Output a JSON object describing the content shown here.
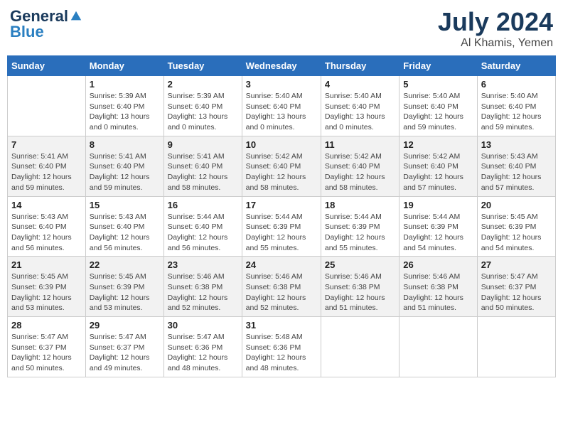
{
  "header": {
    "logo_general": "General",
    "logo_blue": "Blue",
    "month_year": "July 2024",
    "location": "Al Khamis, Yemen"
  },
  "days_of_week": [
    "Sunday",
    "Monday",
    "Tuesday",
    "Wednesday",
    "Thursday",
    "Friday",
    "Saturday"
  ],
  "weeks": [
    [
      {
        "day": "",
        "sunrise": "",
        "sunset": "",
        "daylight": ""
      },
      {
        "day": "1",
        "sunrise": "Sunrise: 5:39 AM",
        "sunset": "Sunset: 6:40 PM",
        "daylight": "Daylight: 13 hours and 0 minutes."
      },
      {
        "day": "2",
        "sunrise": "Sunrise: 5:39 AM",
        "sunset": "Sunset: 6:40 PM",
        "daylight": "Daylight: 13 hours and 0 minutes."
      },
      {
        "day": "3",
        "sunrise": "Sunrise: 5:40 AM",
        "sunset": "Sunset: 6:40 PM",
        "daylight": "Daylight: 13 hours and 0 minutes."
      },
      {
        "day": "4",
        "sunrise": "Sunrise: 5:40 AM",
        "sunset": "Sunset: 6:40 PM",
        "daylight": "Daylight: 13 hours and 0 minutes."
      },
      {
        "day": "5",
        "sunrise": "Sunrise: 5:40 AM",
        "sunset": "Sunset: 6:40 PM",
        "daylight": "Daylight: 12 hours and 59 minutes."
      },
      {
        "day": "6",
        "sunrise": "Sunrise: 5:40 AM",
        "sunset": "Sunset: 6:40 PM",
        "daylight": "Daylight: 12 hours and 59 minutes."
      }
    ],
    [
      {
        "day": "7",
        "sunrise": "Sunrise: 5:41 AM",
        "sunset": "Sunset: 6:40 PM",
        "daylight": "Daylight: 12 hours and 59 minutes."
      },
      {
        "day": "8",
        "sunrise": "Sunrise: 5:41 AM",
        "sunset": "Sunset: 6:40 PM",
        "daylight": "Daylight: 12 hours and 59 minutes."
      },
      {
        "day": "9",
        "sunrise": "Sunrise: 5:41 AM",
        "sunset": "Sunset: 6:40 PM",
        "daylight": "Daylight: 12 hours and 58 minutes."
      },
      {
        "day": "10",
        "sunrise": "Sunrise: 5:42 AM",
        "sunset": "Sunset: 6:40 PM",
        "daylight": "Daylight: 12 hours and 58 minutes."
      },
      {
        "day": "11",
        "sunrise": "Sunrise: 5:42 AM",
        "sunset": "Sunset: 6:40 PM",
        "daylight": "Daylight: 12 hours and 58 minutes."
      },
      {
        "day": "12",
        "sunrise": "Sunrise: 5:42 AM",
        "sunset": "Sunset: 6:40 PM",
        "daylight": "Daylight: 12 hours and 57 minutes."
      },
      {
        "day": "13",
        "sunrise": "Sunrise: 5:43 AM",
        "sunset": "Sunset: 6:40 PM",
        "daylight": "Daylight: 12 hours and 57 minutes."
      }
    ],
    [
      {
        "day": "14",
        "sunrise": "Sunrise: 5:43 AM",
        "sunset": "Sunset: 6:40 PM",
        "daylight": "Daylight: 12 hours and 56 minutes."
      },
      {
        "day": "15",
        "sunrise": "Sunrise: 5:43 AM",
        "sunset": "Sunset: 6:40 PM",
        "daylight": "Daylight: 12 hours and 56 minutes."
      },
      {
        "day": "16",
        "sunrise": "Sunrise: 5:44 AM",
        "sunset": "Sunset: 6:40 PM",
        "daylight": "Daylight: 12 hours and 56 minutes."
      },
      {
        "day": "17",
        "sunrise": "Sunrise: 5:44 AM",
        "sunset": "Sunset: 6:39 PM",
        "daylight": "Daylight: 12 hours and 55 minutes."
      },
      {
        "day": "18",
        "sunrise": "Sunrise: 5:44 AM",
        "sunset": "Sunset: 6:39 PM",
        "daylight": "Daylight: 12 hours and 55 minutes."
      },
      {
        "day": "19",
        "sunrise": "Sunrise: 5:44 AM",
        "sunset": "Sunset: 6:39 PM",
        "daylight": "Daylight: 12 hours and 54 minutes."
      },
      {
        "day": "20",
        "sunrise": "Sunrise: 5:45 AM",
        "sunset": "Sunset: 6:39 PM",
        "daylight": "Daylight: 12 hours and 54 minutes."
      }
    ],
    [
      {
        "day": "21",
        "sunrise": "Sunrise: 5:45 AM",
        "sunset": "Sunset: 6:39 PM",
        "daylight": "Daylight: 12 hours and 53 minutes."
      },
      {
        "day": "22",
        "sunrise": "Sunrise: 5:45 AM",
        "sunset": "Sunset: 6:39 PM",
        "daylight": "Daylight: 12 hours and 53 minutes."
      },
      {
        "day": "23",
        "sunrise": "Sunrise: 5:46 AM",
        "sunset": "Sunset: 6:38 PM",
        "daylight": "Daylight: 12 hours and 52 minutes."
      },
      {
        "day": "24",
        "sunrise": "Sunrise: 5:46 AM",
        "sunset": "Sunset: 6:38 PM",
        "daylight": "Daylight: 12 hours and 52 minutes."
      },
      {
        "day": "25",
        "sunrise": "Sunrise: 5:46 AM",
        "sunset": "Sunset: 6:38 PM",
        "daylight": "Daylight: 12 hours and 51 minutes."
      },
      {
        "day": "26",
        "sunrise": "Sunrise: 5:46 AM",
        "sunset": "Sunset: 6:38 PM",
        "daylight": "Daylight: 12 hours and 51 minutes."
      },
      {
        "day": "27",
        "sunrise": "Sunrise: 5:47 AM",
        "sunset": "Sunset: 6:37 PM",
        "daylight": "Daylight: 12 hours and 50 minutes."
      }
    ],
    [
      {
        "day": "28",
        "sunrise": "Sunrise: 5:47 AM",
        "sunset": "Sunset: 6:37 PM",
        "daylight": "Daylight: 12 hours and 50 minutes."
      },
      {
        "day": "29",
        "sunrise": "Sunrise: 5:47 AM",
        "sunset": "Sunset: 6:37 PM",
        "daylight": "Daylight: 12 hours and 49 minutes."
      },
      {
        "day": "30",
        "sunrise": "Sunrise: 5:47 AM",
        "sunset": "Sunset: 6:36 PM",
        "daylight": "Daylight: 12 hours and 48 minutes."
      },
      {
        "day": "31",
        "sunrise": "Sunrise: 5:48 AM",
        "sunset": "Sunset: 6:36 PM",
        "daylight": "Daylight: 12 hours and 48 minutes."
      },
      {
        "day": "",
        "sunrise": "",
        "sunset": "",
        "daylight": ""
      },
      {
        "day": "",
        "sunrise": "",
        "sunset": "",
        "daylight": ""
      },
      {
        "day": "",
        "sunrise": "",
        "sunset": "",
        "daylight": ""
      }
    ]
  ]
}
